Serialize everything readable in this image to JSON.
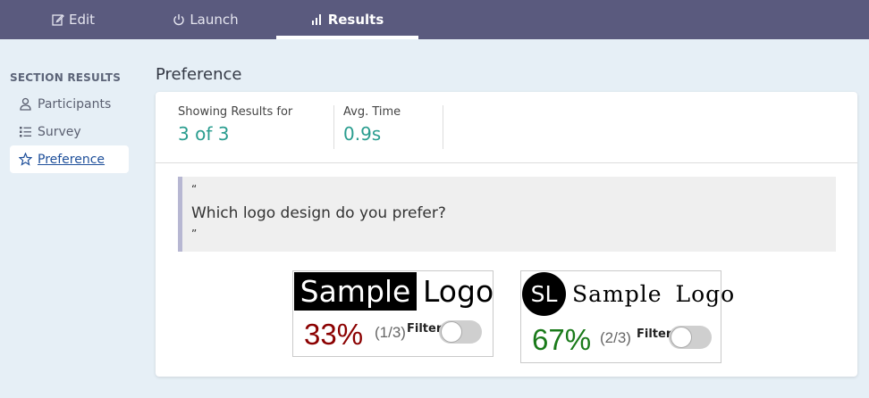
{
  "nav": {
    "tabs": [
      {
        "label": "Edit",
        "icon": "edit-icon"
      },
      {
        "label": "Launch",
        "icon": "power-icon"
      },
      {
        "label": "Results",
        "icon": "bar-chart-icon"
      }
    ],
    "active_tab": "Results"
  },
  "sidebar": {
    "heading": "SECTION RESULTS",
    "items": [
      {
        "label": "Participants",
        "icon": "user-icon"
      },
      {
        "label": "Survey",
        "icon": "list-icon"
      },
      {
        "label": "Preference",
        "icon": "star-icon"
      }
    ],
    "active_item": "Preference"
  },
  "main": {
    "title": "Preference",
    "stats": {
      "results_label": "Showing Results for",
      "results_value": "3 of 3",
      "time_label": "Avg. Time",
      "time_value": "0.9s"
    },
    "question": {
      "open_quote": "“",
      "text": "Which logo design do you prefer?",
      "close_quote": "”"
    },
    "options": [
      {
        "logo_highlight": "Sample",
        "logo_text": "Logo",
        "percent": "33%",
        "fraction": "(1/3)",
        "filter_label": "Filter",
        "filter_on": false
      },
      {
        "logo_badge": "SL",
        "logo_text": "Sample Logo",
        "percent": "67%",
        "fraction": "(2/3)",
        "filter_label": "Filter",
        "filter_on": false
      }
    ]
  },
  "colors": {
    "topbar": "#5a5a7e",
    "background": "#e6eff6",
    "accent_teal": "#2a9d8f",
    "percent_low": "#8b0000",
    "percent_high": "#1a7a1a"
  }
}
